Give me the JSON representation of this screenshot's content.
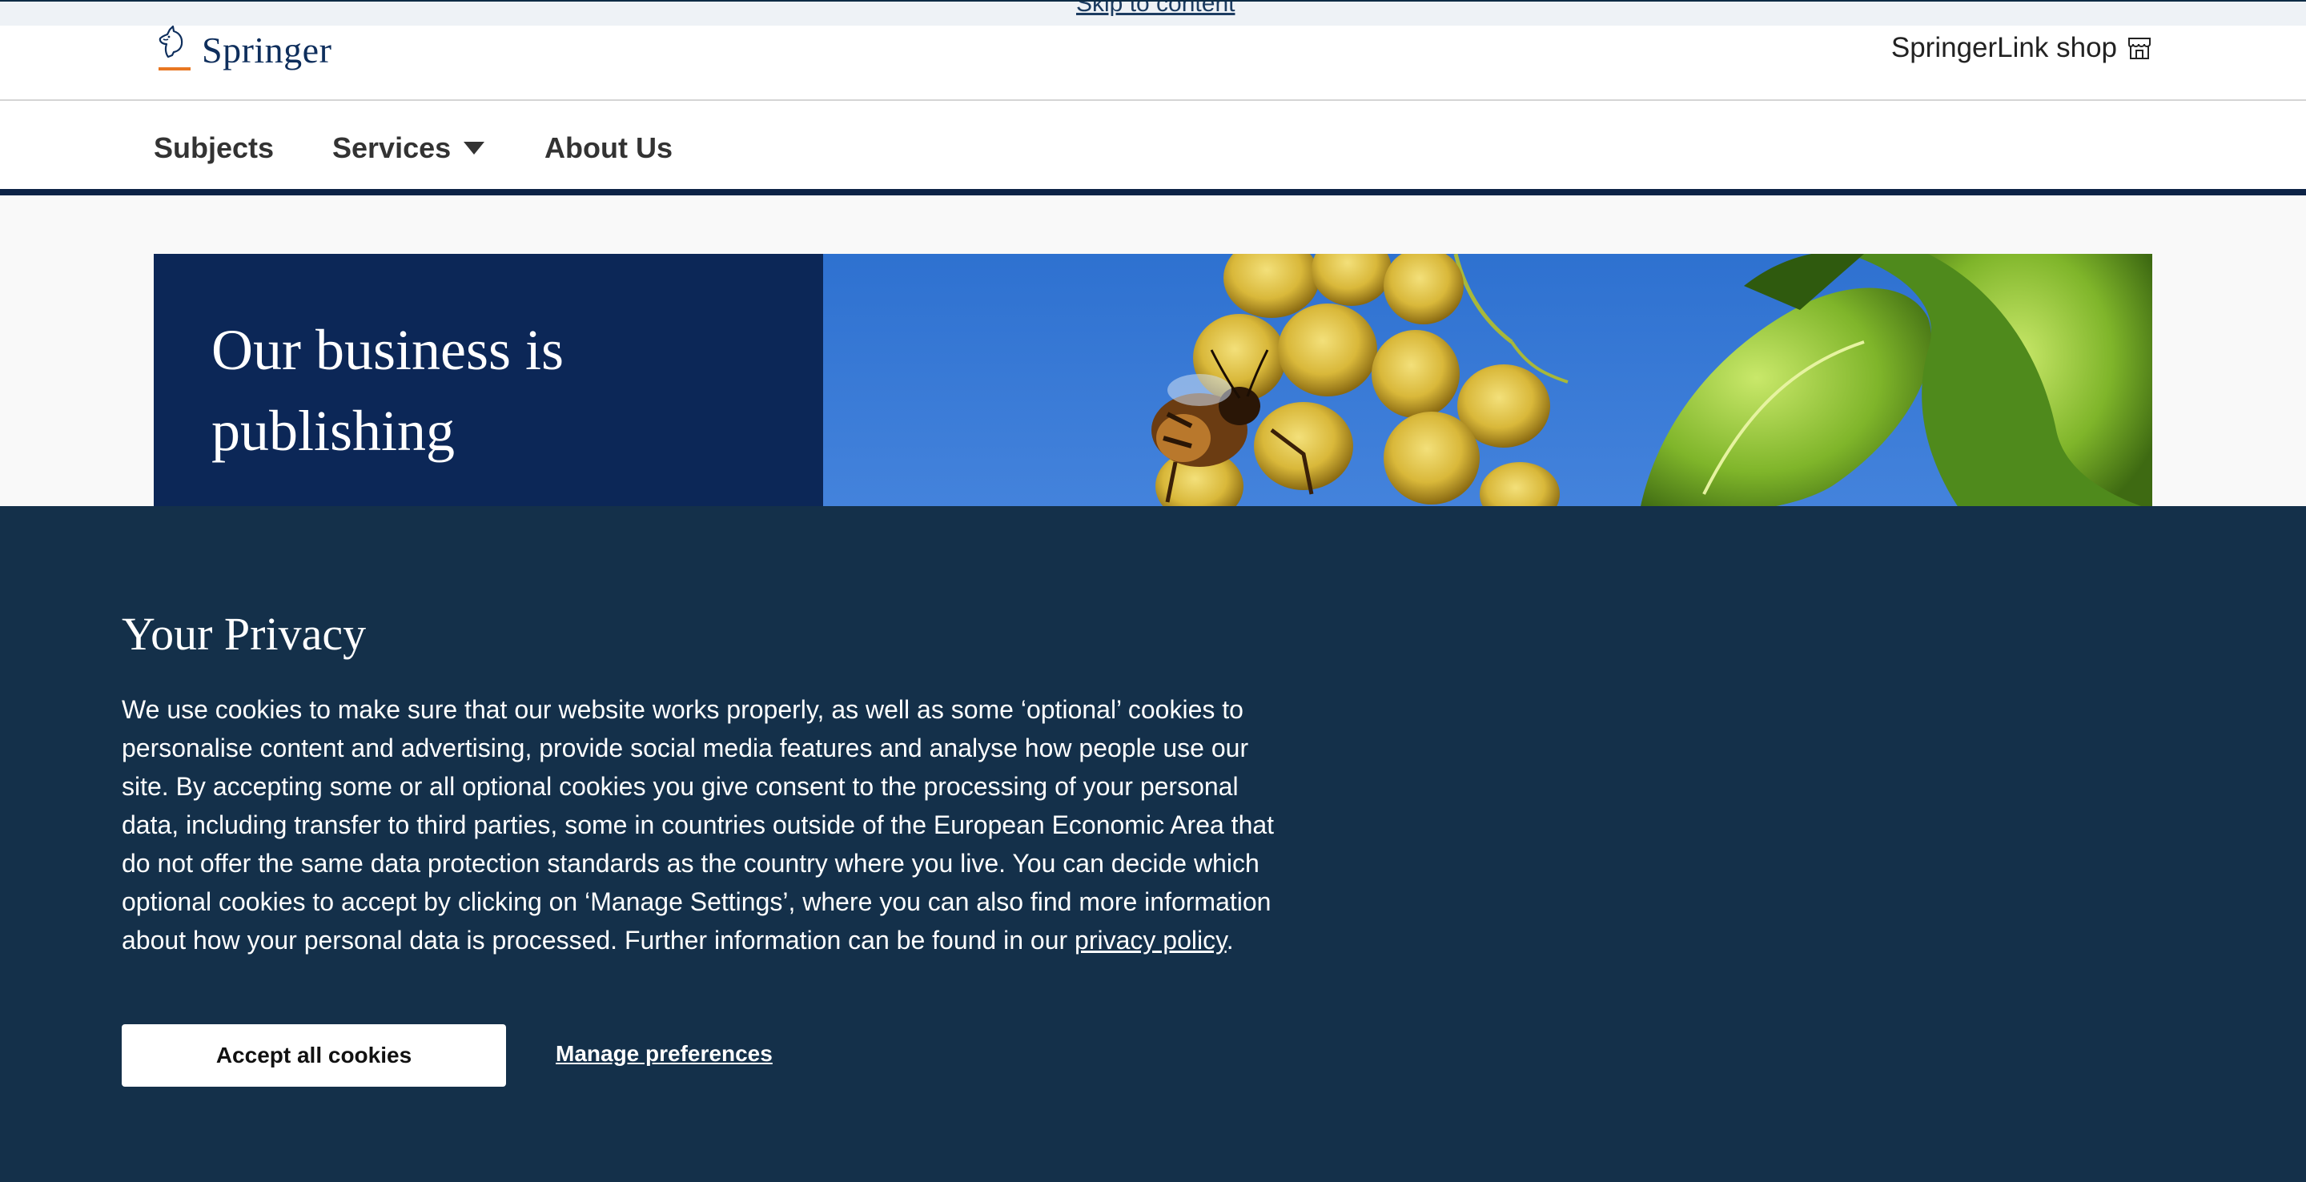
{
  "skip_link": "Skip to content",
  "header": {
    "logo_text": "Springer",
    "shop_link": "SpringerLink shop",
    "shop_icon": "storefront-icon",
    "logo_icon": "springer-horse-logo-icon"
  },
  "nav": {
    "items": [
      {
        "label": "Subjects"
      },
      {
        "label": "Services",
        "icon": "caret-down-icon"
      },
      {
        "label": "About Us"
      }
    ]
  },
  "hero": {
    "title": "Our business is publishing",
    "image": "bee-on-yellow-flowers-photo"
  },
  "privacy": {
    "title": "Your Privacy",
    "body": "We use cookies to make sure that our website works properly, as well as some ‘optional’ cookies to personalise content and advertising, provide social media features and analyse how people use our site. By accepting some or all optional cookies you give consent to the processing of your personal data, including transfer to third parties, some in countries outside of the European Economic Area that do not offer the same data protection standards as the country where you live. You can decide which optional cookies to accept by clicking on ‘Manage Settings’, where you can also find more information about how your personal data is processed. Further information can be found in our ",
    "policy_link": "privacy policy",
    "period": ".",
    "accept_label": "Accept all cookies",
    "manage_label": "Manage preferences"
  },
  "colors": {
    "brand_navy": "#0c2757",
    "banner_bg": "#14304a",
    "nav_border": "#0d2346",
    "logo_accent": "#e87722"
  }
}
